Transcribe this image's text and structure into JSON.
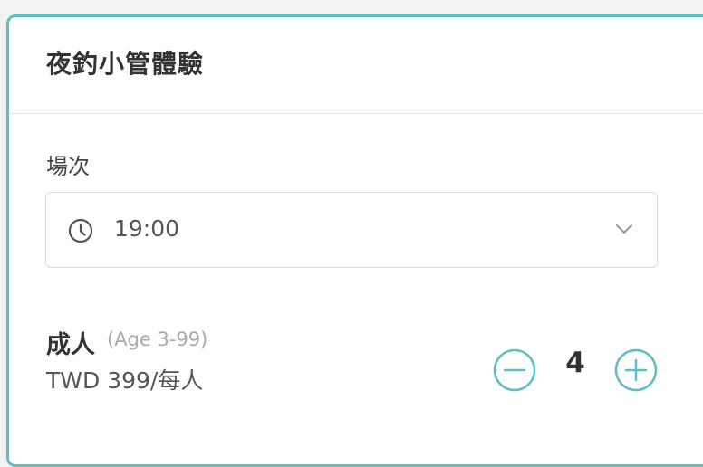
{
  "product": {
    "title": "夜釣小管體驗"
  },
  "session": {
    "label": "場次",
    "selected_time": "19:00",
    "clock_icon": "clock-icon",
    "dropdown_icon": "chevron-down-icon"
  },
  "tickets": [
    {
      "name": "成人",
      "age_range": "(Age 3-99)",
      "price": "TWD 399/每人",
      "quantity": "4",
      "decrement_icon": "minus-circle-icon",
      "increment_icon": "plus-circle-icon"
    }
  ],
  "colors": {
    "accent": "#5bbfc4",
    "text_primary": "#333333",
    "text_secondary": "#555555",
    "text_muted": "#aaaaaa"
  }
}
